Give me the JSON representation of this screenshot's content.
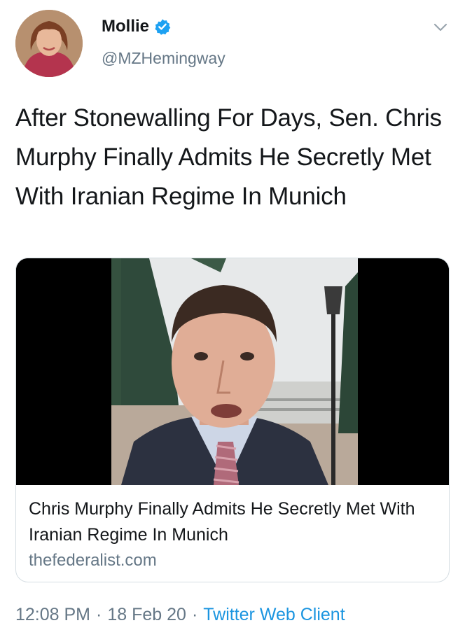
{
  "author": {
    "display_name": "Mollie",
    "handle": "@MZHemingway",
    "verified": true,
    "avatar_icon": "user-avatar"
  },
  "tweet": {
    "text": "After Stonewalling For Days, Sen. Chris Murphy Finally Admits He Secretly Met With Iranian Regime In Munich"
  },
  "card": {
    "title": "Chris Murphy Finally Admits He Secretly Met With Iranian Regime In Munich",
    "domain": "thefederalist.com"
  },
  "meta": {
    "time": "12:08 PM",
    "separator": "·",
    "date": "18 Feb 20",
    "source": "Twitter Web Client"
  },
  "colors": {
    "text": "#14171a",
    "secondary": "#657786",
    "link": "#1b95e0",
    "verified": "#1da1f2",
    "border": "#d6dee3"
  }
}
